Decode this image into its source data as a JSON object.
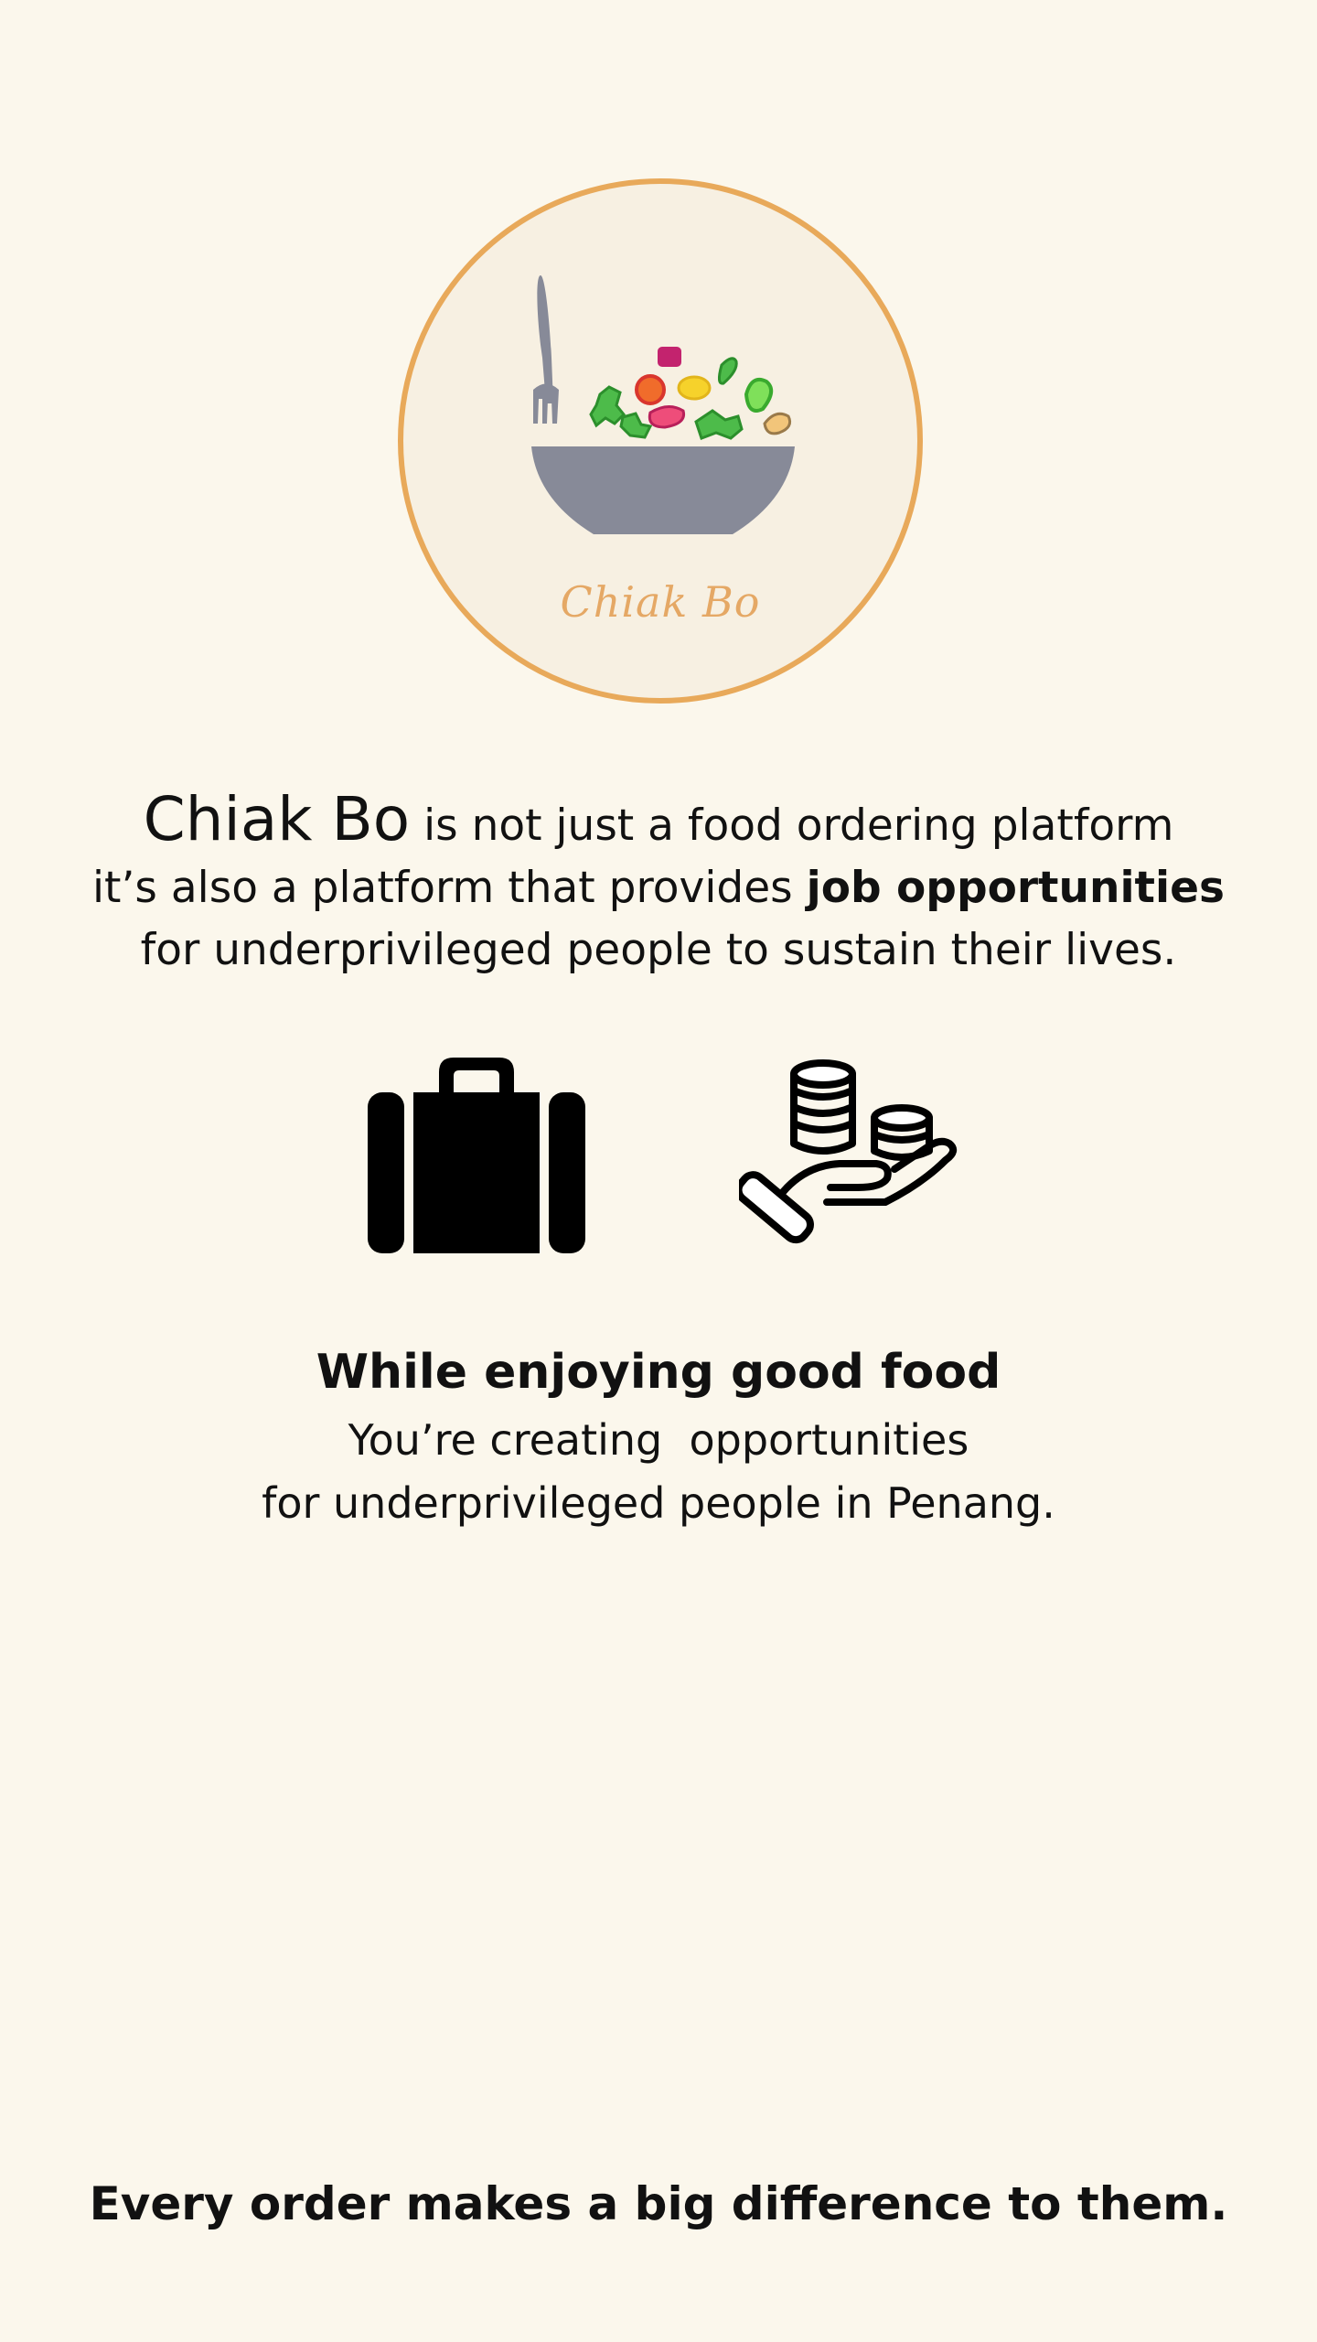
{
  "logo": {
    "name": "Chiak Bo",
    "accent_color": "#e8a95a",
    "bowl_color": "#878a98",
    "icons": [
      "fork-icon",
      "salad-bowl-icon"
    ]
  },
  "intro": {
    "brand": "Chiak Bo",
    "line1_rest": " is not just a food ordering platform",
    "line2_pre": "it’s also a platform that provides ",
    "line2_bold": "job opportunities",
    "line3": "for underprivileged people to sustain their lives."
  },
  "icons_row": [
    "briefcase-icon",
    "hand-coins-icon"
  ],
  "highlight": {
    "title": "While enjoying good food",
    "line1": "You’re creating  opportunities",
    "line2": "for underprivileged people in Penang."
  },
  "footer": {
    "text": "Every order makes a big difference to them."
  }
}
